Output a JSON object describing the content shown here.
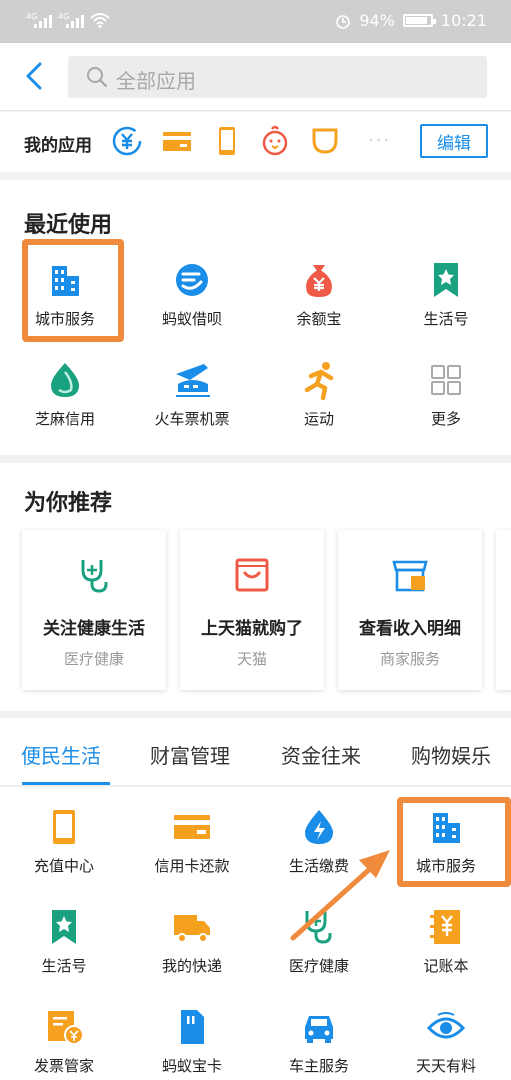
{
  "status_bar": {
    "net1": "4G",
    "net2": "4G",
    "battery": "94%",
    "time": "10:21"
  },
  "search": {
    "placeholder": "全部应用"
  },
  "my_apps": {
    "title": "我的应用",
    "icons": [
      "yuan-transfer-icon",
      "card-icon",
      "phone-icon",
      "chick-icon",
      "cup-icon"
    ],
    "more": "···",
    "edit": "编辑"
  },
  "recent": {
    "title": "最近使用",
    "items": [
      {
        "label": "城市服务",
        "icon": "city-building-icon"
      },
      {
        "label": "蚂蚁借呗",
        "icon": "ant-borrow-icon"
      },
      {
        "label": "余额宝",
        "icon": "money-bag-icon"
      },
      {
        "label": "生活号",
        "icon": "bookmark-star-icon"
      },
      {
        "label": "芝麻信用",
        "icon": "sesame-drop-icon"
      },
      {
        "label": "火车票机票",
        "icon": "train-plane-icon"
      },
      {
        "label": "运动",
        "icon": "runner-icon"
      },
      {
        "label": "更多",
        "icon": "grid-more-icon"
      }
    ]
  },
  "recommend": {
    "title": "为你推荐",
    "cards": [
      {
        "title": "关注健康生活",
        "sub": "医疗健康",
        "icon": "stethoscope-icon"
      },
      {
        "title": "上天猫就购了",
        "sub": "天猫",
        "icon": "tmall-bag-icon"
      },
      {
        "title": "查看收入明细",
        "sub": "商家服务",
        "icon": "shop-icon"
      }
    ]
  },
  "tabs": [
    "便民生活",
    "财富管理",
    "资金往来",
    "购物娱乐"
  ],
  "life": {
    "items": [
      {
        "label": "充值中心",
        "icon": "phone-recharge-icon"
      },
      {
        "label": "信用卡还款",
        "icon": "credit-card-icon"
      },
      {
        "label": "生活缴费",
        "icon": "utility-drop-icon"
      },
      {
        "label": "城市服务",
        "icon": "city-building-icon"
      },
      {
        "label": "生活号",
        "icon": "bookmark-star-icon"
      },
      {
        "label": "我的快递",
        "icon": "truck-icon"
      },
      {
        "label": "医疗健康",
        "icon": "stethoscope-icon"
      },
      {
        "label": "记账本",
        "icon": "ledger-icon"
      },
      {
        "label": "发票管家",
        "icon": "invoice-icon"
      },
      {
        "label": "蚂蚁宝卡",
        "icon": "sim-card-icon"
      },
      {
        "label": "车主服务",
        "icon": "car-icon"
      },
      {
        "label": "天天有料",
        "icon": "eye-icon"
      }
    ]
  },
  "colors": {
    "accent": "#1a8de8",
    "highlight": "#f08a3c",
    "orange": "#f5a01f",
    "green": "#1aa180",
    "red": "#ee5a45"
  }
}
